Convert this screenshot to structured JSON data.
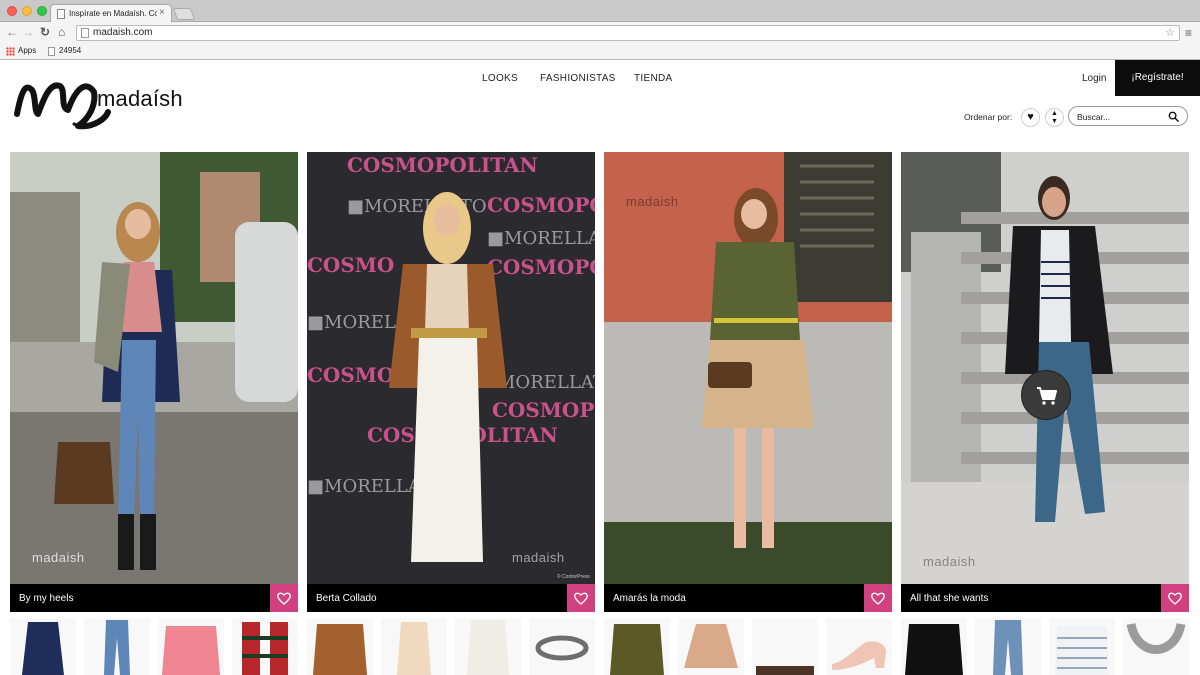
{
  "browser": {
    "tab_title": "Inspírate en Madaísh. Com",
    "tab_close": "×",
    "url": "madaish.com",
    "bookmarks": [
      {
        "label": "Apps"
      },
      {
        "label": "24954"
      }
    ]
  },
  "site": {
    "logo_text": "madaísh",
    "nav": {
      "looks": "LOOKS",
      "fashionistas": "FASHIONISTAS",
      "tienda": "TIENDA"
    },
    "login": "Login",
    "register": "¡Regístrate!",
    "sort_label": "Ordenar por:",
    "search_placeholder": "Buscar...",
    "watermark": "madaish",
    "accent_color": "#d2417f"
  },
  "cards": [
    {
      "title": "By my heels",
      "thumbs": [
        "navy-coat",
        "jeans",
        "pink-sweater",
        "plaid-scarf"
      ]
    },
    {
      "title": "Berta Collado",
      "thumbs": [
        "leather-jacket",
        "cream-top",
        "white-trousers",
        "silver-belt"
      ],
      "photo_credit": "© ContorPress"
    },
    {
      "title": "Amarás la moda",
      "thumbs": [
        "green-cardigan",
        "beige-skirt",
        "brown-bag",
        "nude-heels"
      ]
    },
    {
      "title": "All that she wants",
      "thumbs": [
        "black-blazer",
        "jeans",
        "striped-tee",
        "statement-necklace"
      ]
    }
  ],
  "icons": {
    "heart": "heart-icon",
    "cart": "cart-icon",
    "search": "search-icon"
  }
}
